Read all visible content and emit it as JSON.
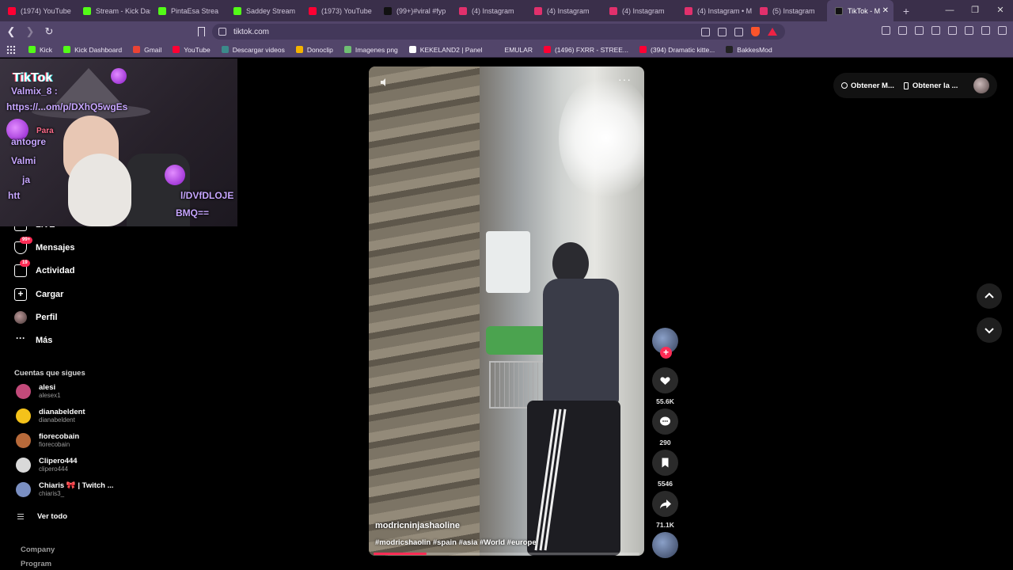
{
  "browser": {
    "tabs": [
      {
        "label": "(1974) YouTube",
        "color": "#ff0033"
      },
      {
        "label": "Stream - Kick Das",
        "color": "#53fc18"
      },
      {
        "label": "PintaEsa Strea",
        "color": "#53fc18"
      },
      {
        "label": "Saddey Stream",
        "color": "#53fc18"
      },
      {
        "label": "(1973) YouTube",
        "color": "#ff0033"
      },
      {
        "label": "(99+)#viral #fyp",
        "color": "#111111"
      },
      {
        "label": "(4) Instagram",
        "color": "#e1306c"
      },
      {
        "label": "(4) Instagram",
        "color": "#e1306c"
      },
      {
        "label": "(4) Instagram",
        "color": "#e1306c"
      },
      {
        "label": "(4) Instagram • M",
        "color": "#e1306c"
      },
      {
        "label": "(5) Instagram",
        "color": "#e1306c"
      }
    ],
    "active_tab": {
      "label": "TikTok - M",
      "color": "#111111"
    },
    "new_tab": "+",
    "url": "tiktok.com",
    "bookmarks": [
      {
        "label": "Kick",
        "color": "#53fc18"
      },
      {
        "label": "Kick Dashboard",
        "color": "#53fc18"
      },
      {
        "label": "Gmail",
        "color": "#ea4335"
      },
      {
        "label": "YouTube",
        "color": "#ff0033"
      },
      {
        "label": "Descargar videos",
        "color": "#3b8a8a"
      },
      {
        "label": "Donoclip",
        "color": "#f5b400"
      },
      {
        "label": "Imagenes png",
        "color": "#6fbf73"
      },
      {
        "label": "KEKELAND2 | Panel",
        "color": "#ffffff"
      },
      {
        "label": "EMULAR",
        "color": "#52456a"
      },
      {
        "label": "(1496) FXRR - STREE...",
        "color": "#ff0033"
      },
      {
        "label": "(394) Dramatic kitte...",
        "color": "#ff0033"
      },
      {
        "label": "BakkesMod",
        "color": "#222222"
      }
    ]
  },
  "overlay": {
    "logo": "TikTok",
    "chat_lines": [
      "Valmix_8 :",
      "https://...om/p/DXhQ5wgEs",
      "Para",
      "antogre",
      "Valmi",
      "ja",
      "htt",
      "l/DVfDLOJE",
      "BMQ=="
    ]
  },
  "sidebar": {
    "items": [
      {
        "label": "LIVE"
      },
      {
        "label": "Mensajes",
        "badge": "99+"
      },
      {
        "label": "Actividad",
        "badge": "19"
      },
      {
        "label": "Cargar"
      },
      {
        "label": "Perfil"
      },
      {
        "label": "Más"
      }
    ],
    "following_title": "Cuentas que sigues",
    "following": [
      {
        "name": "alesi",
        "handle": "alesex1",
        "color": "#c24a7a"
      },
      {
        "name": "dianabeldent",
        "handle": "dianabeldent",
        "color": "#f4c21a"
      },
      {
        "name": "fiorecobain",
        "handle": "fiorecobain",
        "color": "#b86a3a"
      },
      {
        "name": "Clipero444",
        "handle": "clipero444",
        "color": "#d9d9d9"
      },
      {
        "name": "Chiaris 🎀 | Twitch ...",
        "handle": "chiaris3_",
        "color": "#7a8fc2"
      }
    ],
    "see_all": "Ver todo",
    "footer": [
      "Company",
      "Program"
    ]
  },
  "video": {
    "author": "modricninjashaoline",
    "tags": "#modricshaolin #spain #asia #World #europe",
    "progress": 0.2
  },
  "actions": {
    "likes": "55.6K",
    "comments": "290",
    "saves": "5546",
    "shares": "71.1K"
  },
  "topbar": {
    "get_coins": "Obtener M...",
    "get_app": "Obtener la ..."
  }
}
